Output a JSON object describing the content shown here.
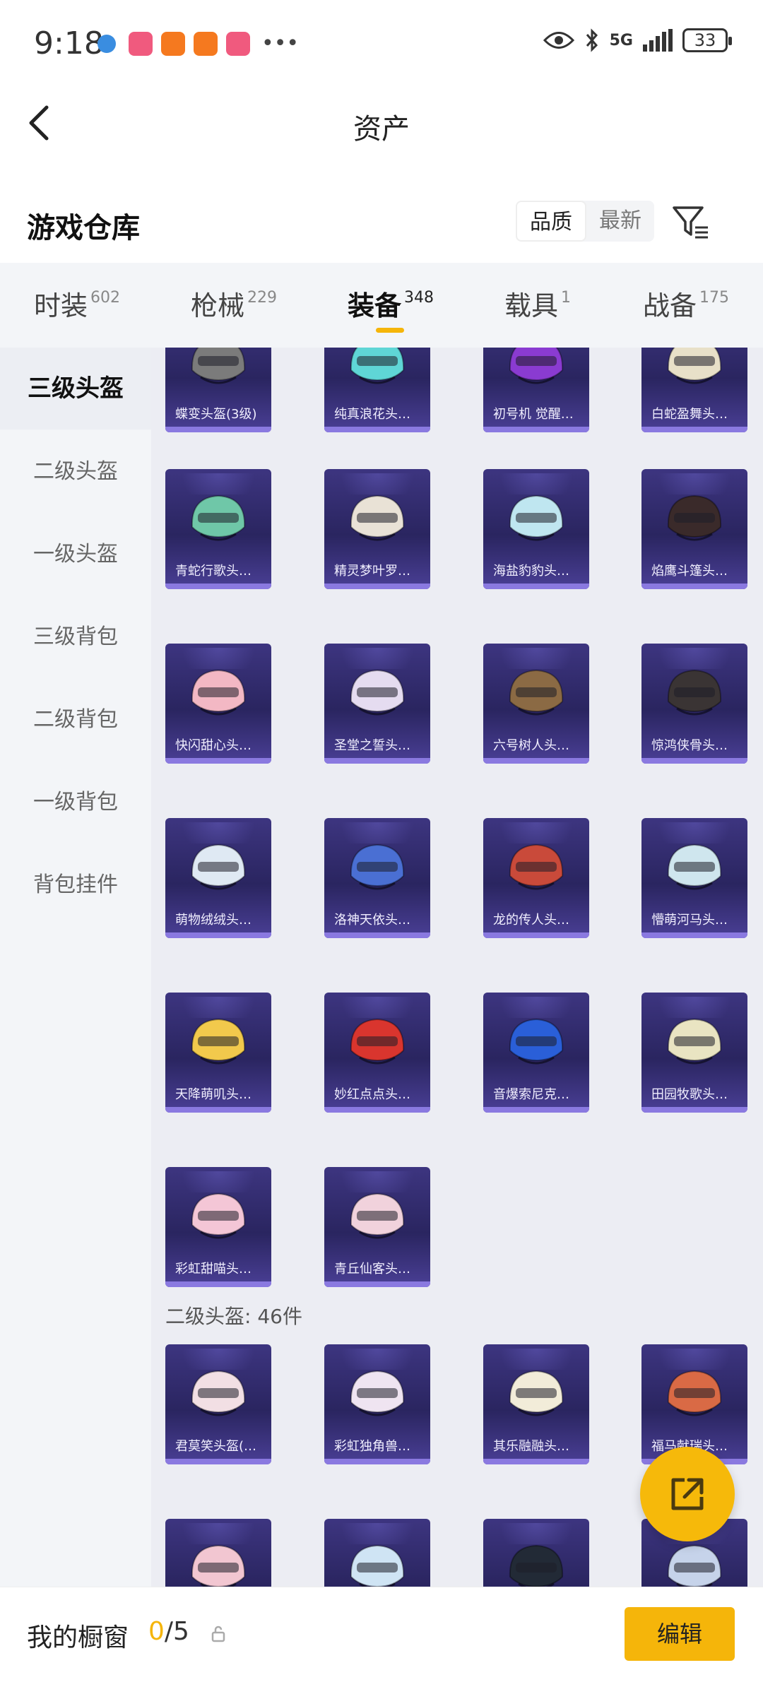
{
  "status": {
    "time": "9:18",
    "network": "5G",
    "battery": "33"
  },
  "header": {
    "title": "资产"
  },
  "section": {
    "title": "游戏仓库",
    "sort_options": [
      "品质",
      "最新"
    ]
  },
  "tabs": [
    {
      "label": "时装",
      "count": "602"
    },
    {
      "label": "枪械",
      "count": "229"
    },
    {
      "label": "装备",
      "count": "348"
    },
    {
      "label": "载具",
      "count": "1"
    },
    {
      "label": "战备",
      "count": "175"
    }
  ],
  "sidebar": {
    "items": [
      {
        "label": "三级头盔"
      },
      {
        "label": "二级头盔"
      },
      {
        "label": "一级头盔"
      },
      {
        "label": "三级背包"
      },
      {
        "label": "二级背包"
      },
      {
        "label": "一级背包"
      },
      {
        "label": "背包挂件"
      }
    ]
  },
  "grid": {
    "rows": [
      [
        "蝶变头盔(3级)",
        "纯真浪花头…",
        "初号机 觉醒…",
        "白蛇盈舞头…"
      ],
      [
        "青蛇行歌头…",
        "精灵梦叶罗…",
        "海盐豹豹头…",
        "焰鹰斗篷头…"
      ],
      [
        "快闪甜心头…",
        "圣堂之誓头…",
        "六号树人头…",
        "惊鸿侠骨头…"
      ],
      [
        "萌物绒绒头…",
        "洛神天依头…",
        "龙的传人头…",
        "懵萌河马头…"
      ],
      [
        "天降萌叽头…",
        "妙红点点头…",
        "音爆索尼克…",
        "田园牧歌头…"
      ],
      [
        "彩虹甜喵头…",
        "青丘仙客头…"
      ]
    ],
    "group2_label": "二级头盔: 46件",
    "group2_rows": [
      [
        "君莫笑头盔(…",
        "彩虹独角兽…",
        "其乐融融头…",
        "福马献瑞头…"
      ],
      [
        "",
        "",
        "",
        ""
      ]
    ]
  },
  "helmet_colors": [
    [
      "#7b7b7b",
      "#5fd6d6",
      "#8a3bd1",
      "#e8e0c8"
    ],
    [
      "#6fc7a8",
      "#e9e2d6",
      "#bfe6f0",
      "#3a2a2a"
    ],
    [
      "#f3b8c4",
      "#e5dcf0",
      "#8b6a44",
      "#3a3434"
    ],
    [
      "#dfe9f3",
      "#4a6fd3",
      "#c94a3a",
      "#cfe6ee"
    ],
    [
      "#f2c94c",
      "#d9352e",
      "#2a5fd8",
      "#e9e4c2"
    ],
    [
      "#f4c6d6",
      "#f1d2dc"
    ],
    [
      "#f2dfe4",
      "#efe4f1",
      "#f2ecd9",
      "#d96a45"
    ],
    [
      "#f2c6d1",
      "#cfe4f4",
      "#222a36",
      "#c6d3ea"
    ]
  ],
  "bottom": {
    "label": "我的橱窗",
    "count_current": "0",
    "count_total": "/5",
    "edit_label": "编辑"
  }
}
